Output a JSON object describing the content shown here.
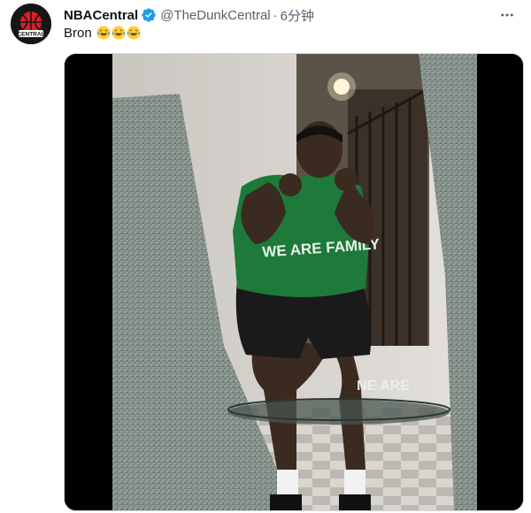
{
  "tweet": {
    "display_name": "NBACentral",
    "handle": "@TheDunkCentral",
    "separator": "·",
    "time": "6分钟",
    "text": "Bron",
    "emojis": [
      "😂",
      "😂",
      "😂"
    ],
    "avatar_text": "CENTRAL",
    "verified": true
  },
  "media": {
    "video_text": "WE ARE FAMILY",
    "reflection_text": "NE ARE"
  },
  "colors": {
    "verified_blue": "#1d9bf0",
    "muted": "#536471",
    "border": "#cfd9de"
  },
  "icons": {
    "more": "more-horizontal-icon",
    "verified": "verified-badge-icon"
  }
}
